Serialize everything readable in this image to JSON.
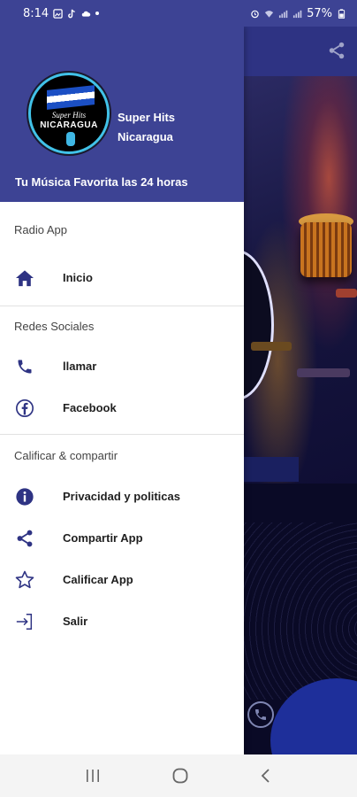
{
  "status_bar": {
    "time": "8:14",
    "battery": "57%"
  },
  "drawer": {
    "header": {
      "logo_line1": "Super Hits",
      "logo_line2": "NICARAGUA",
      "app_name_line1": "Super Hits",
      "app_name_line2": "Nicaragua",
      "tagline": "Tu Música Favorita las 24 horas"
    },
    "sections": [
      {
        "title": "Radio App",
        "items": [
          {
            "label": "Inicio",
            "icon": "home-icon"
          }
        ]
      },
      {
        "title": "Redes Sociales",
        "items": [
          {
            "label": "llamar",
            "icon": "phone-icon"
          },
          {
            "label": "Facebook",
            "icon": "facebook-icon"
          }
        ]
      },
      {
        "title": "Calificar & compartir",
        "items": [
          {
            "label": "Privacidad y politicas",
            "icon": "info-icon"
          },
          {
            "label": "Compartir App",
            "icon": "share-icon"
          },
          {
            "label": "Calificar App",
            "icon": "star-icon"
          },
          {
            "label": "Salir",
            "icon": "exit-icon"
          }
        ]
      }
    ]
  },
  "colors": {
    "primary": "#3d4394",
    "icon_accent": "#2e3383"
  }
}
